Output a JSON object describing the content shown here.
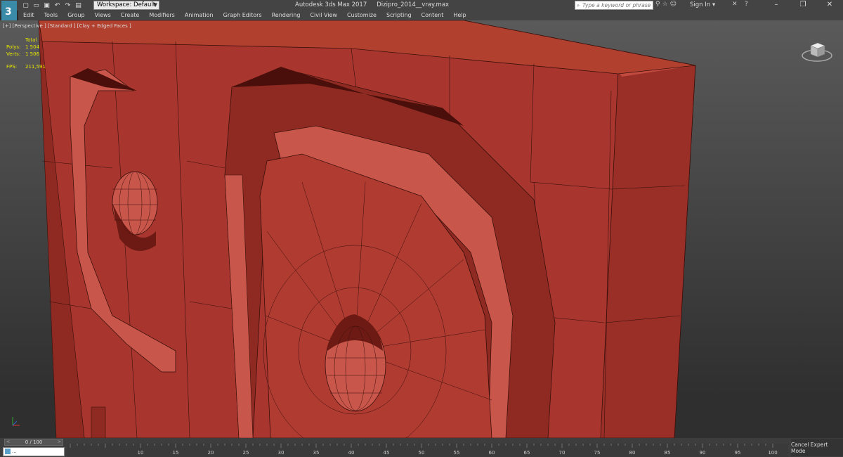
{
  "titlebar": {
    "workspace_label": "Workspace: Default",
    "app_name": "Autodesk 3ds Max 2017",
    "file_name": "Dizipro_2014__vray.max",
    "search_placeholder": "Type a keyword or phrase",
    "signin_label": "Sign In"
  },
  "menu": {
    "items": [
      "Edit",
      "Tools",
      "Group",
      "Views",
      "Create",
      "Modifiers",
      "Animation",
      "Graph Editors",
      "Rendering",
      "Civil View",
      "Customize",
      "Scripting",
      "Content",
      "Help"
    ]
  },
  "viewport": {
    "label": "[+] [Perspective ] [Standard ] [Clay + Edged Faces ]",
    "stats": {
      "header": "Total",
      "polys_label": "Polys:",
      "polys_value": "1 504",
      "verts_label": "Verts:",
      "verts_value": "1 506",
      "fps_label": "FPS:",
      "fps_value": "211,591"
    }
  },
  "timeline": {
    "frame_label": "0 / 100",
    "ticks": [
      10,
      15,
      20,
      25,
      30,
      35,
      40,
      45,
      50,
      55,
      60,
      65,
      70,
      75,
      80,
      85,
      90,
      95,
      100
    ],
    "maxscript_text": "...",
    "cancel_expert_label": "Cancel Expert Mode"
  },
  "colors": {
    "clay": "#a8362e",
    "clay_light": "#c8564a",
    "clay_dark": "#6e1a14",
    "edge": "#3a0f0b",
    "stats": "#e6e600",
    "ui_bg": "#444444"
  },
  "icons": [
    "app-logo-icon",
    "new-icon",
    "open-icon",
    "save-icon",
    "undo-icon",
    "redo-icon",
    "project-icon",
    "search-icon",
    "star-icon",
    "binoculars-icon",
    "user-icon",
    "help-icon",
    "minimize-icon",
    "restore-icon",
    "close-icon",
    "viewcube-icon",
    "axis-tripod-icon",
    "maxscript-icon"
  ]
}
